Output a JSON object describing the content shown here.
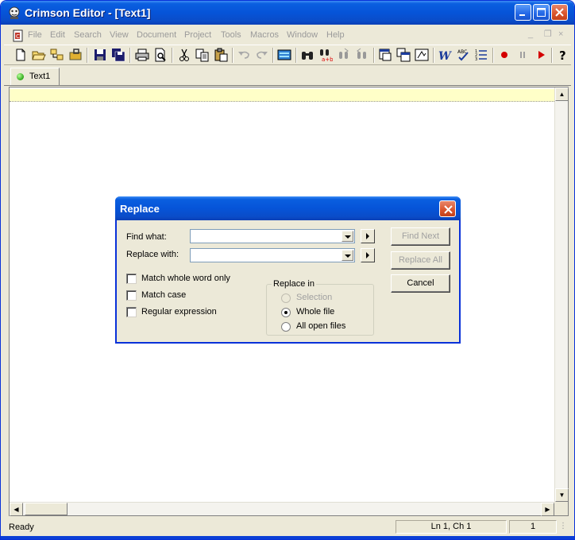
{
  "window": {
    "title": "Crimson Editor - [Text1]"
  },
  "menu": {
    "items": [
      "File",
      "Edit",
      "Search",
      "View",
      "Document",
      "Project",
      "Tools",
      "Macros",
      "Window",
      "Help"
    ]
  },
  "tabs": [
    {
      "label": "Text1"
    }
  ],
  "dialog": {
    "title": "Replace",
    "find_label": "Find what:",
    "find_value": "",
    "replace_label": "Replace with:",
    "replace_value": "",
    "options": {
      "match_whole_word": {
        "label": "Match whole word only",
        "checked": false
      },
      "match_case": {
        "label": "Match case",
        "checked": false
      },
      "regular_expression": {
        "label": "Regular expression",
        "checked": false
      }
    },
    "replace_in": {
      "title": "Replace in",
      "selection": "Selection",
      "whole_file": "Whole file",
      "all_open_files": "All open files",
      "selected": "Whole file"
    },
    "buttons": {
      "find_next": "Find Next",
      "replace_all": "Replace All",
      "cancel": "Cancel"
    }
  },
  "status": {
    "text": "Ready",
    "position": "Ln 1, Ch 1",
    "column_number": "1"
  },
  "colors": {
    "titlebar": "#0654d8",
    "current_line": "#ffffc8",
    "window_bg": "#ece9d8"
  }
}
